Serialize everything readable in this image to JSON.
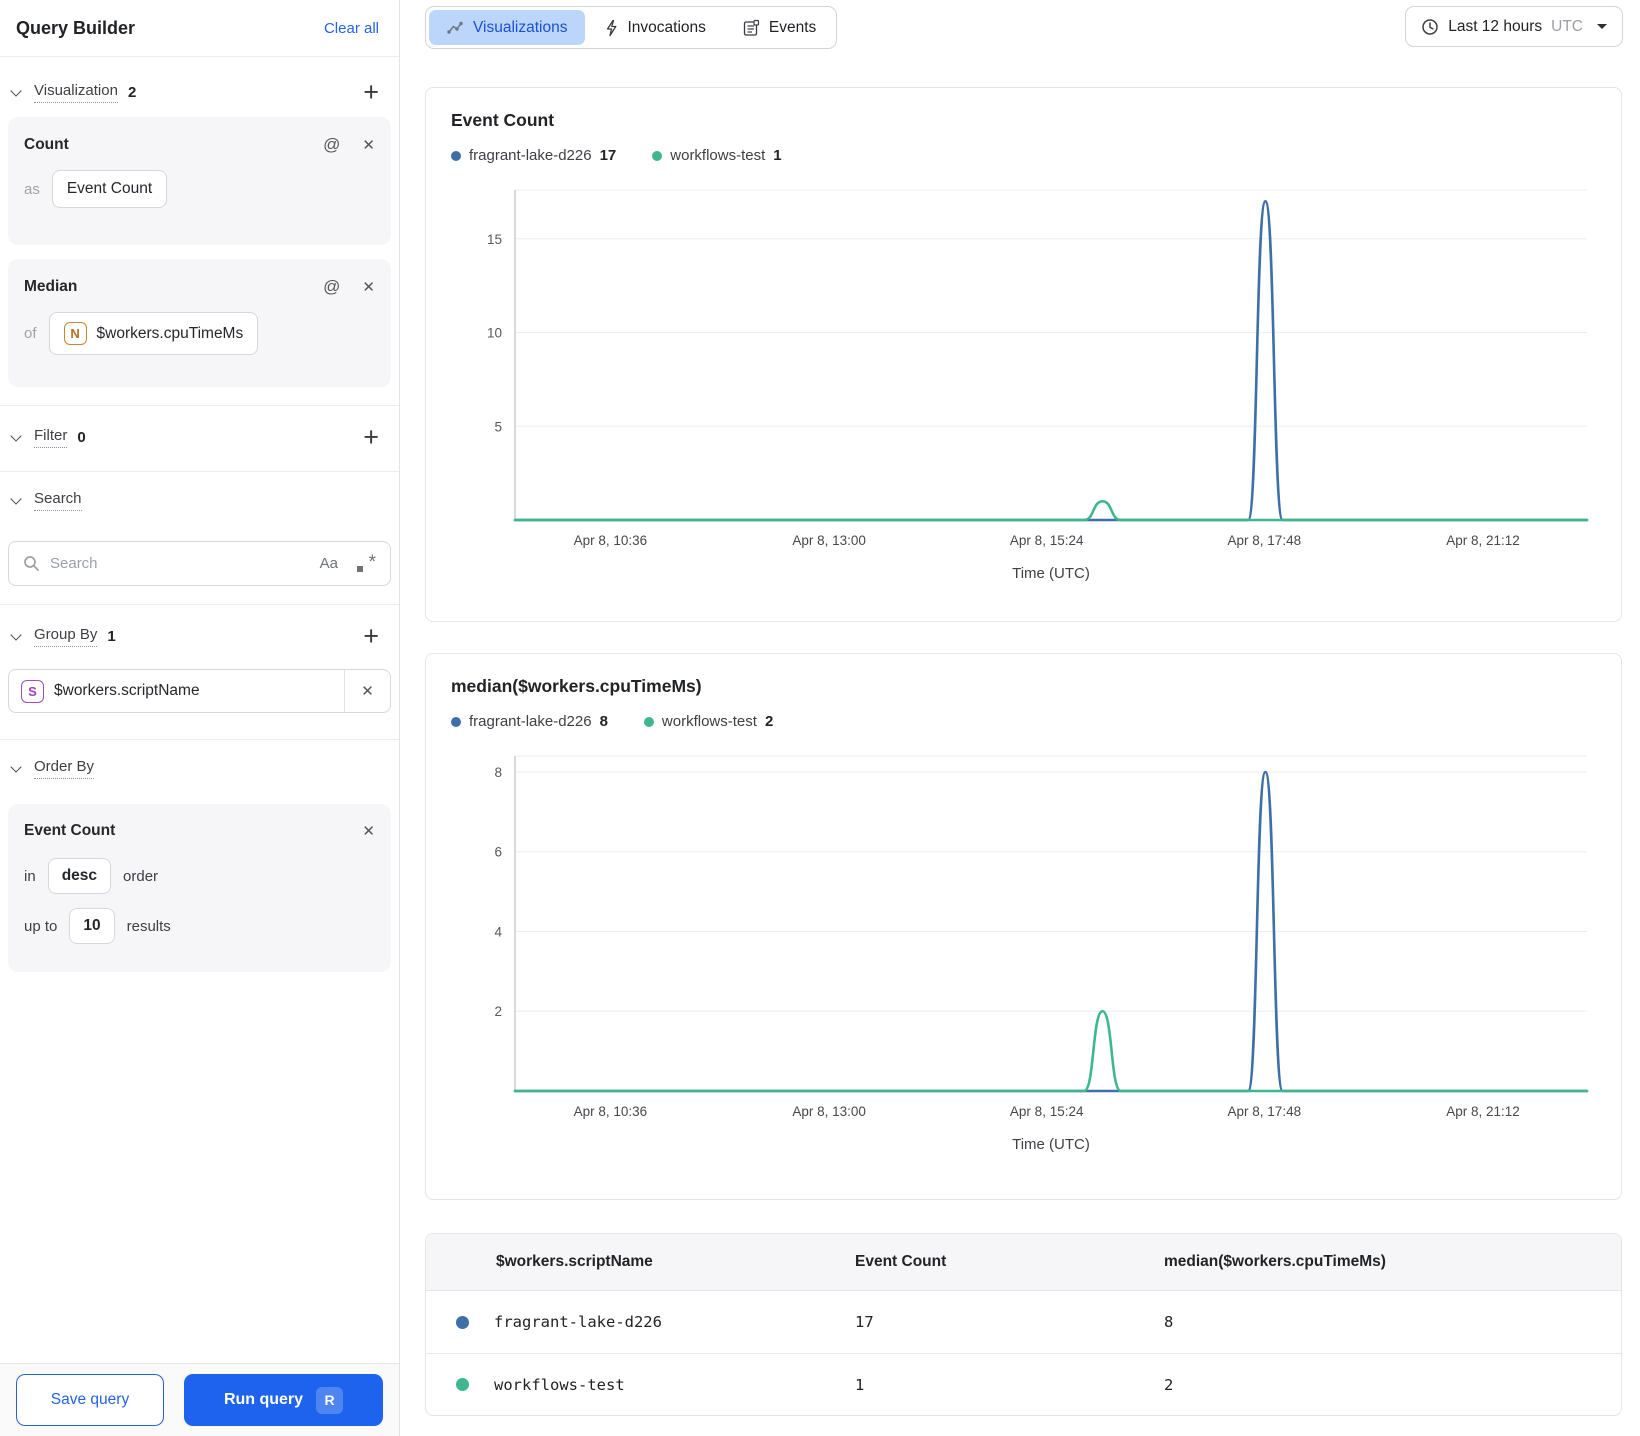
{
  "sidebar": {
    "title": "Query Builder",
    "clear_all": "Clear all",
    "visualization": {
      "label": "Visualization",
      "count": "2",
      "cards": [
        {
          "title": "Count",
          "prefix": "as",
          "value": "Event Count"
        },
        {
          "title": "Median",
          "prefix": "of",
          "value": "$workers.cpuTimeMs",
          "badge": "N"
        }
      ]
    },
    "filter": {
      "label": "Filter",
      "count": "0"
    },
    "search": {
      "label": "Search",
      "placeholder": "Search",
      "case_toggle": "Aa"
    },
    "group_by": {
      "label": "Group By",
      "count": "1",
      "items": [
        {
          "badge": "S",
          "value": "$workers.scriptName"
        }
      ]
    },
    "order_by": {
      "label": "Order By",
      "card": {
        "title": "Event Count",
        "in_label": "in",
        "direction": "desc",
        "order_label": "order",
        "up_to_label": "up to",
        "limit": "10",
        "results_label": "results"
      }
    },
    "footer": {
      "save": "Save query",
      "run": "Run query",
      "run_shortcut": "R"
    }
  },
  "topbar": {
    "tabs": [
      {
        "label": "Visualizations",
        "active": true
      },
      {
        "label": "Invocations",
        "active": false
      },
      {
        "label": "Events",
        "active": false
      }
    ],
    "time_range": {
      "label": "Last 12 hours",
      "zone": "UTC"
    }
  },
  "colors": {
    "series_blue": "#3d6fa8",
    "series_green": "#3cb88c",
    "accent_blue": "#1e63ee",
    "active_tab_bg": "#bcd6fb",
    "active_tab_text": "#1b4fd6"
  },
  "chart_data": [
    {
      "type": "line",
      "title": "Event Count",
      "xlabel": "Time (UTC)",
      "grid": true,
      "legend_position": "top",
      "ylim": [
        0,
        17.6
      ],
      "y_ticks": [
        5,
        10,
        15
      ],
      "x_ticks": [
        {
          "label": "Apr 8, 10:36",
          "f": 0.089
        },
        {
          "label": "Apr 8, 13:00",
          "f": 0.293
        },
        {
          "label": "Apr 8, 15:24",
          "f": 0.496
        },
        {
          "label": "Apr 8, 17:48",
          "f": 0.699
        },
        {
          "label": "Apr 8, 21:12",
          "f": 0.903
        }
      ],
      "legend": [
        {
          "name": "fragrant-lake-d226",
          "value": "17",
          "color": "#3d6fa8"
        },
        {
          "name": "workflows-test",
          "value": "1",
          "color": "#3cb88c"
        }
      ],
      "series": [
        {
          "name": "fragrant-lake-d226",
          "color": "#3d6fa8",
          "baseline": 0,
          "peaks": [
            {
              "center_f": 0.7,
              "half_width_f": 0.016,
              "value": 17
            }
          ]
        },
        {
          "name": "workflows-test",
          "color": "#3cb88c",
          "baseline": 0,
          "peaks": [
            {
              "center_f": 0.548,
              "half_width_f": 0.017,
              "value": 1
            }
          ]
        }
      ]
    },
    {
      "type": "line",
      "title": "median($workers.cpuTimeMs)",
      "xlabel": "Time (UTC)",
      "grid": true,
      "legend_position": "top",
      "ylim": [
        0,
        8.4
      ],
      "y_ticks": [
        2,
        4,
        6,
        8
      ],
      "x_ticks": [
        {
          "label": "Apr 8, 10:36",
          "f": 0.089
        },
        {
          "label": "Apr 8, 13:00",
          "f": 0.293
        },
        {
          "label": "Apr 8, 15:24",
          "f": 0.496
        },
        {
          "label": "Apr 8, 17:48",
          "f": 0.699
        },
        {
          "label": "Apr 8, 21:12",
          "f": 0.903
        }
      ],
      "legend": [
        {
          "name": "fragrant-lake-d226",
          "value": "8",
          "color": "#3d6fa8"
        },
        {
          "name": "workflows-test",
          "value": "2",
          "color": "#3cb88c"
        }
      ],
      "series": [
        {
          "name": "fragrant-lake-d226",
          "color": "#3d6fa8",
          "baseline": 0,
          "peaks": [
            {
              "center_f": 0.7,
              "half_width_f": 0.016,
              "value": 8
            }
          ]
        },
        {
          "name": "workflows-test",
          "color": "#3cb88c",
          "baseline": 0,
          "peaks": [
            {
              "center_f": 0.548,
              "half_width_f": 0.017,
              "value": 2
            }
          ]
        }
      ]
    }
  ],
  "table": {
    "columns": [
      "$workers.scriptName",
      "Event Count",
      "median($workers.cpuTimeMs)"
    ],
    "rows": [
      {
        "script_name": "fragrant-lake-d226",
        "color": "#3d6fa8",
        "event_count": "17",
        "median": "8"
      },
      {
        "script_name": "workflows-test",
        "color": "#3cb88c",
        "event_count": "1",
        "median": "2"
      }
    ]
  }
}
